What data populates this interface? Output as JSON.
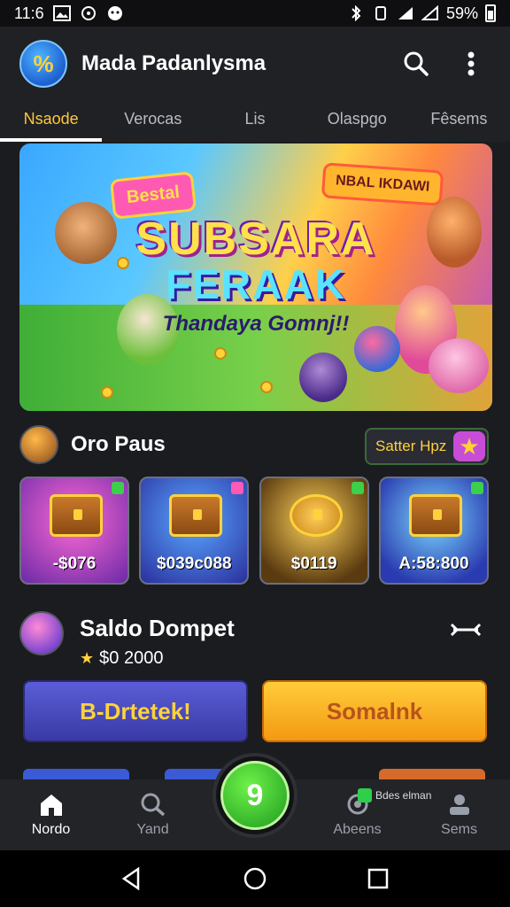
{
  "status_bar": {
    "time": "11:6",
    "battery": "59%"
  },
  "header": {
    "logo_text": "%",
    "title": "Mada Padanlysma"
  },
  "tabs": [
    {
      "label": "Nsaode",
      "active": true
    },
    {
      "label": "Verocas",
      "active": false
    },
    {
      "label": "Lis",
      "active": false
    },
    {
      "label": "Olaspgo",
      "active": false
    },
    {
      "label": "Fêsems",
      "active": false
    }
  ],
  "banner": {
    "badge_left": "Bestal",
    "badge_right": "NBAL IKDAWI",
    "title_line1": "SUBSARA",
    "title_line2": "FERAAK",
    "subtitle": "Thandaya Gomnj!!"
  },
  "offers": {
    "title": "Oro Paus",
    "action_label": "Satter Hpz",
    "cards": [
      {
        "price": "-$076"
      },
      {
        "price": "$039c088"
      },
      {
        "price": "$0119"
      },
      {
        "price": "A:58:800"
      }
    ]
  },
  "balance": {
    "title": "Saldo Dompet",
    "amount": "$0 2000",
    "primary_button": "B-Drtetek!",
    "secondary_button": "Somalnk"
  },
  "bottom_nav": [
    {
      "label": "Nordo",
      "icon": "home-icon",
      "active": true
    },
    {
      "label": "Yand",
      "icon": "search-icon",
      "active": false
    },
    {
      "label": "Abeens",
      "icon": "support-icon",
      "active": false
    },
    {
      "label": "Sems",
      "icon": "account-icon",
      "active": false
    }
  ],
  "nav_badge": "Bdes elman",
  "fab_label": "9",
  "colors": {
    "accent": "#ffc83a",
    "background": "#1b1c20",
    "primary": "#4a4ac0",
    "secondary": "#ffb52e"
  }
}
